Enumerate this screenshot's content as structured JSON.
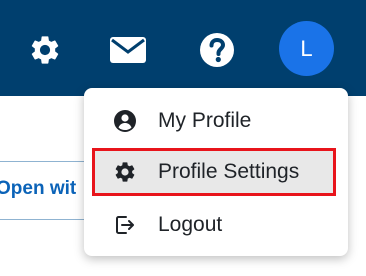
{
  "header": {
    "icons": {
      "settings": "gear-icon",
      "mail": "mail-icon",
      "help": "help-icon"
    },
    "avatar_initial": "L"
  },
  "page": {
    "open_with_text": "Open wit"
  },
  "menu": {
    "items": [
      {
        "label": "My Profile",
        "icon": "user-circle-icon"
      },
      {
        "label": "Profile Settings",
        "icon": "gear-icon",
        "highlighted": true
      },
      {
        "label": "Logout",
        "icon": "logout-icon"
      }
    ]
  },
  "colors": {
    "header_bg": "#003f6e",
    "avatar_bg": "#1a73e8",
    "highlight_border": "#e8141b",
    "link": "#0b63b8"
  }
}
